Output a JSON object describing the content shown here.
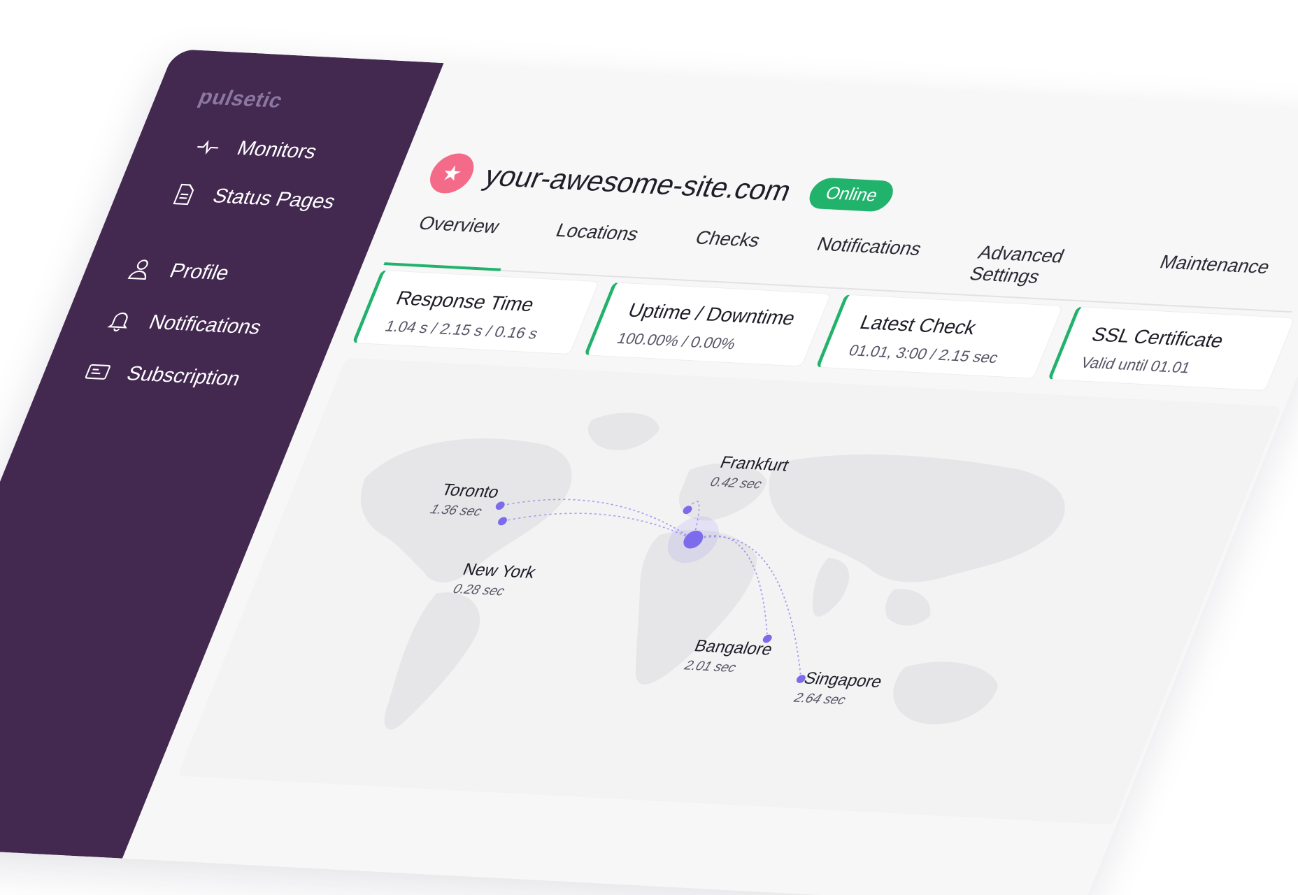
{
  "app": {
    "logo": "pulsetic"
  },
  "sidebar": {
    "items": [
      {
        "label": "Monitors",
        "icon": "pulse-icon"
      },
      {
        "label": "Status Pages",
        "icon": "document-icon"
      },
      {
        "label": "Profile",
        "icon": "user-icon"
      },
      {
        "label": "Notifications",
        "icon": "bell-icon"
      },
      {
        "label": "Subscription",
        "icon": "card-icon"
      }
    ]
  },
  "site": {
    "title": "your-awesome-site.com",
    "status": "Online",
    "icon": "star-icon"
  },
  "tabs": [
    "Overview",
    "Locations",
    "Checks",
    "Notifications",
    "Advanced Settings",
    "Maintenance"
  ],
  "active_tab": "Overview",
  "cards": [
    {
      "title": "Response Time",
      "value": "1.04 s / 2.15 s / 0.16 s"
    },
    {
      "title": "Uptime / Downtime",
      "value": "100.00% / 0.00%"
    },
    {
      "title": "Latest Check",
      "value": "01.01, 3:00 / 2.15 sec"
    },
    {
      "title": "SSL Certificate",
      "value": "Valid until 01.01"
    }
  ],
  "locations": [
    {
      "name": "Toronto",
      "time": "1.36 sec"
    },
    {
      "name": "New York",
      "time": "0.28 sec"
    },
    {
      "name": "Frankfurt",
      "time": "0.42 sec"
    },
    {
      "name": "Bangalore",
      "time": "2.01 sec"
    },
    {
      "name": "Singapore",
      "time": "2.64 sec"
    }
  ],
  "colors": {
    "sidebar": "#432850",
    "accent": "#21b26c",
    "dot": "#7c6bea",
    "site_icon": "#f46b8a"
  }
}
